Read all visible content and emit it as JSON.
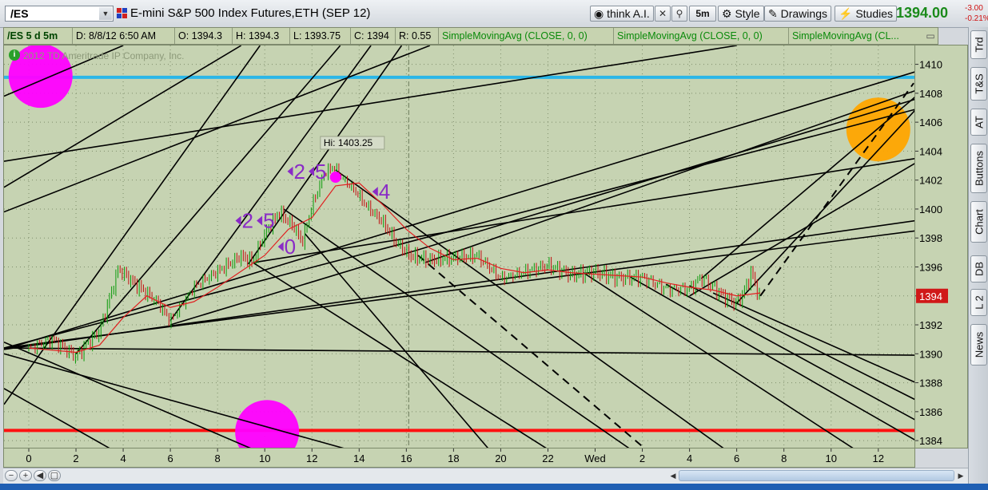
{
  "toolbar": {
    "symbol": "/ES",
    "title": "E-mini S&P 500 Index Futures,ETH (SEP 12)",
    "think_ai": "think A.I.",
    "interval": "5m",
    "style": "Style",
    "drawings": "Drawings",
    "studies": "Studies",
    "last_price": "1394.00",
    "net_change": "-3.00",
    "pct_change": "-0.21%"
  },
  "infobar": {
    "symbol_period": "/ES 5 d 5m",
    "datetime": "D: 8/8/12 6:50 AM",
    "open": "O: 1394.3",
    "high": "H: 1394.3",
    "low": "L: 1393.75",
    "close": "C: 1394",
    "range": "R: 0.55",
    "studies": [
      "SimpleMovingAvg (CLOSE, 0, 0)",
      "SimpleMovingAvg (CLOSE, 0, 0)",
      "SimpleMovingAvg (CL..."
    ]
  },
  "watermark": "2012 TD Ameritrade IP Company, Inc.",
  "sidebar": [
    "Trd",
    "T&S",
    "AT",
    "Buttons",
    "Chart",
    "DB",
    "L 2",
    "News"
  ],
  "colors": {
    "up_bar": "#0a9a0a",
    "down_bar": "#c01010",
    "sma": "#e02020",
    "cyan_level": "#2ab6e8",
    "red_level": "#ff1010",
    "magenta_marker": "#ff00ff",
    "orange_marker": "#ffa500",
    "count_label": "#8a2bc6"
  },
  "chart_data": {
    "type": "candlestick",
    "title": "E-mini S&P 500 Index Futures,ETH (SEP 12)",
    "xlabel": "",
    "ylabel": "",
    "ylim": [
      1383.4,
      1411.3
    ],
    "y_ticks": [
      1384,
      1386,
      1388,
      1390,
      1392,
      1394,
      1396,
      1398,
      1400,
      1402,
      1404,
      1406,
      1408,
      1410
    ],
    "x_ticks": [
      {
        "label": "0",
        "t": 0
      },
      {
        "label": "2",
        "t": 2
      },
      {
        "label": "4",
        "t": 4
      },
      {
        "label": "6",
        "t": 6
      },
      {
        "label": "8",
        "t": 8
      },
      {
        "label": "10",
        "t": 10
      },
      {
        "label": "12",
        "t": 12
      },
      {
        "label": "14",
        "t": 14
      },
      {
        "label": "16",
        "t": 16
      },
      {
        "label": "18",
        "t": 18
      },
      {
        "label": "20",
        "t": 20
      },
      {
        "label": "22",
        "t": 22
      },
      {
        "label": "Wed",
        "t": 24
      },
      {
        "label": "2",
        "t": 26
      },
      {
        "label": "4",
        "t": 28
      },
      {
        "label": "6",
        "t": 30
      },
      {
        "label": "8",
        "t": 32
      },
      {
        "label": "10",
        "t": 34
      },
      {
        "label": "12",
        "t": 36
      }
    ],
    "xlim": [
      -1.05,
      37.6
    ],
    "price_path": [
      [
        0,
        1390.5
      ],
      [
        1,
        1391.0
      ],
      [
        2,
        1389.8
      ],
      [
        3,
        1391.5
      ],
      [
        3.8,
        1395.8
      ],
      [
        4.5,
        1394.8
      ],
      [
        5.5,
        1393.5
      ],
      [
        6,
        1392.3
      ],
      [
        7,
        1394.7
      ],
      [
        8,
        1395.7
      ],
      [
        9,
        1396.7
      ],
      [
        9.5,
        1396.3
      ],
      [
        10,
        1398.2
      ],
      [
        10.6,
        1399.7
      ],
      [
        11.2,
        1398.8
      ],
      [
        11.6,
        1397.7
      ],
      [
        12,
        1400.2
      ],
      [
        12.5,
        1402.4
      ],
      [
        12.9,
        1403.0
      ],
      [
        13.3,
        1402.2
      ],
      [
        13.8,
        1401.4
      ],
      [
        14.3,
        1400.3
      ],
      [
        15,
        1399.1
      ],
      [
        15.6,
        1397.6
      ],
      [
        16.2,
        1396.7
      ],
      [
        17,
        1396.4
      ],
      [
        18,
        1396.6
      ],
      [
        19,
        1396.8
      ],
      [
        20,
        1395.3
      ],
      [
        21,
        1395.7
      ],
      [
        22,
        1396.1
      ],
      [
        23,
        1395.4
      ],
      [
        24,
        1395.6
      ],
      [
        25,
        1395.2
      ],
      [
        26,
        1395.3
      ],
      [
        27,
        1394.6
      ],
      [
        28,
        1394.5
      ],
      [
        28.5,
        1395.3
      ],
      [
        29.4,
        1394.0
      ],
      [
        30,
        1393.4
      ],
      [
        30.4,
        1394.5
      ],
      [
        30.6,
        1395.6
      ],
      [
        30.9,
        1394.2
      ],
      [
        31.0,
        1394.0
      ]
    ],
    "sma_path": [
      [
        0,
        1390.4
      ],
      [
        2,
        1390.1
      ],
      [
        3,
        1390.6
      ],
      [
        4,
        1392.5
      ],
      [
        5,
        1394.0
      ],
      [
        6,
        1393.2
      ],
      [
        7,
        1393.6
      ],
      [
        8,
        1394.6
      ],
      [
        9,
        1395.7
      ],
      [
        10,
        1396.8
      ],
      [
        11,
        1398.6
      ],
      [
        12,
        1399.4
      ],
      [
        13,
        1401.6
      ],
      [
        14,
        1401.8
      ],
      [
        15,
        1400.3
      ],
      [
        16,
        1398.6
      ],
      [
        17,
        1397.3
      ],
      [
        18,
        1396.5
      ],
      [
        19,
        1396.6
      ],
      [
        20,
        1395.9
      ],
      [
        21,
        1395.6
      ],
      [
        22,
        1395.8
      ],
      [
        23,
        1395.6
      ],
      [
        24,
        1395.5
      ],
      [
        25,
        1395.4
      ],
      [
        26,
        1395.3
      ],
      [
        27,
        1394.9
      ],
      [
        28,
        1394.6
      ],
      [
        29,
        1394.4
      ],
      [
        30,
        1394.0
      ],
      [
        31,
        1394.2
      ]
    ],
    "horizontal_levels": [
      {
        "price": 1409.1,
        "color": "#2ab6e8"
      },
      {
        "price": 1384.7,
        "color": "#ff1010"
      }
    ],
    "hi_label": "Hi: 1403.25",
    "hi_price": 1403.25,
    "hi_time": 12.9,
    "last_label": "1394",
    "last_price": 1394.0,
    "count_labels": [
      {
        "text": "2",
        "t": 9.3,
        "p": 1399.2
      },
      {
        "text": "5",
        "t": 10.2,
        "p": 1399.2
      },
      {
        "text": "0",
        "t": 11.1,
        "p": 1397.4
      },
      {
        "text": "2",
        "t": 11.5,
        "p": 1402.6
      },
      {
        "text": "5",
        "t": 12.4,
        "p": 1402.6
      },
      {
        "text": "4",
        "t": 15.1,
        "p": 1401.2
      }
    ],
    "trendlines": [
      {
        "t1": -1.05,
        "p1": 1390.3,
        "t2": 37.6,
        "p2": 1409.5
      },
      {
        "t1": -1.05,
        "p1": 1390.4,
        "t2": 37.6,
        "p2": 1406.9
      },
      {
        "t1": -1.05,
        "p1": 1390.4,
        "t2": 37.6,
        "p2": 1398.5
      },
      {
        "t1": -1.05,
        "p1": 1390.4,
        "t2": 37.6,
        "p2": 1389.9
      },
      {
        "t1": -1.05,
        "p1": 1390.3,
        "t2": 37.6,
        "p2": 1399.2
      },
      {
        "t1": -1.05,
        "p1": 1390.0,
        "t2": 13.5,
        "p2": 1383.4
      },
      {
        "t1": -1.05,
        "p1": 1390.8,
        "t2": 9.5,
        "p2": 1383.4
      },
      {
        "t1": -1.05,
        "p1": 1387.6,
        "t2": 3.5,
        "p2": 1383.4
      },
      {
        "t1": -1.05,
        "p1": 1399.8,
        "t2": 17.0,
        "p2": 1411.3
      },
      {
        "t1": -1.05,
        "p1": 1401.5,
        "t2": 9.0,
        "p2": 1411.3
      },
      {
        "t1": -1.05,
        "p1": 1407.8,
        "t2": 4.0,
        "p2": 1411.3
      },
      {
        "t1": -1.05,
        "p1": 1403.3,
        "t2": 30.0,
        "p2": 1411.3
      },
      {
        "t1": 6.0,
        "p1": 1392.0,
        "t2": 37.6,
        "p2": 1407.6
      },
      {
        "t1": 9.5,
        "p1": 1396.3,
        "t2": 37.6,
        "p2": 1403.5
      },
      {
        "t1": 2.0,
        "p1": 1390.0,
        "t2": 13.2,
        "p2": 1411.3
      },
      {
        "t1": 6.0,
        "p1": 1392.3,
        "t2": 14.5,
        "p2": 1411.3
      },
      {
        "t1": 9.3,
        "p1": 1396.2,
        "t2": 15.8,
        "p2": 1411.3
      },
      {
        "t1": -1.05,
        "p1": 1386.5,
        "t2": 9.8,
        "p2": 1411.3
      },
      {
        "t1": 9.5,
        "p1": 1396.3,
        "t2": 22.0,
        "p2": 1383.4
      },
      {
        "t1": 10.8,
        "p1": 1400.0,
        "t2": 25.5,
        "p2": 1383.4
      },
      {
        "t1": 11.7,
        "p1": 1398.3,
        "t2": 19.5,
        "p2": 1383.4
      },
      {
        "t1": 13.0,
        "p1": 1402.7,
        "t2": 29.5,
        "p2": 1383.4
      },
      {
        "t1": 23.5,
        "p1": 1395.6,
        "t2": 35.0,
        "p2": 1383.4
      },
      {
        "t1": 25.5,
        "p1": 1395.3,
        "t2": 37.6,
        "p2": 1384.0
      },
      {
        "t1": 27.0,
        "p1": 1394.8,
        "t2": 37.6,
        "p2": 1385.4
      },
      {
        "t1": 28.0,
        "p1": 1394.7,
        "t2": 37.6,
        "p2": 1386.8
      },
      {
        "t1": 29.0,
        "p1": 1394.2,
        "t2": 37.6,
        "p2": 1388.0
      },
      {
        "t1": 28.0,
        "p1": 1394.0,
        "t2": 37.6,
        "p2": 1403.2
      },
      {
        "t1": 28.5,
        "p1": 1395.2,
        "t2": 37.6,
        "p2": 1407.8
      },
      {
        "t1": 30.0,
        "p1": 1393.5,
        "t2": 37.6,
        "p2": 1406.9
      },
      {
        "t1": 16.8,
        "p1": 1396.3,
        "t2": 37.6,
        "p2": 1408.2
      }
    ],
    "dashed_lines": [
      {
        "t1": 16.5,
        "p1": 1396.8,
        "t2": 26.0,
        "p2": 1383.6
      },
      {
        "t1": 31.0,
        "p1": 1394.0,
        "t2": 37.5,
        "p2": 1408.7
      }
    ],
    "markers": [
      {
        "kind": "circle",
        "color": "#ff00ff",
        "t": 0.5,
        "p": 1409.2
      },
      {
        "kind": "circle",
        "color": "#ff00ff",
        "t": 10.1,
        "p": 1384.6
      },
      {
        "kind": "circle",
        "color": "#ffa500",
        "t": 36.0,
        "p": 1405.5
      },
      {
        "kind": "dot",
        "color": "#ff00ff",
        "t": 13.0,
        "p": 1402.2
      }
    ],
    "cursor_time": 16.1
  }
}
